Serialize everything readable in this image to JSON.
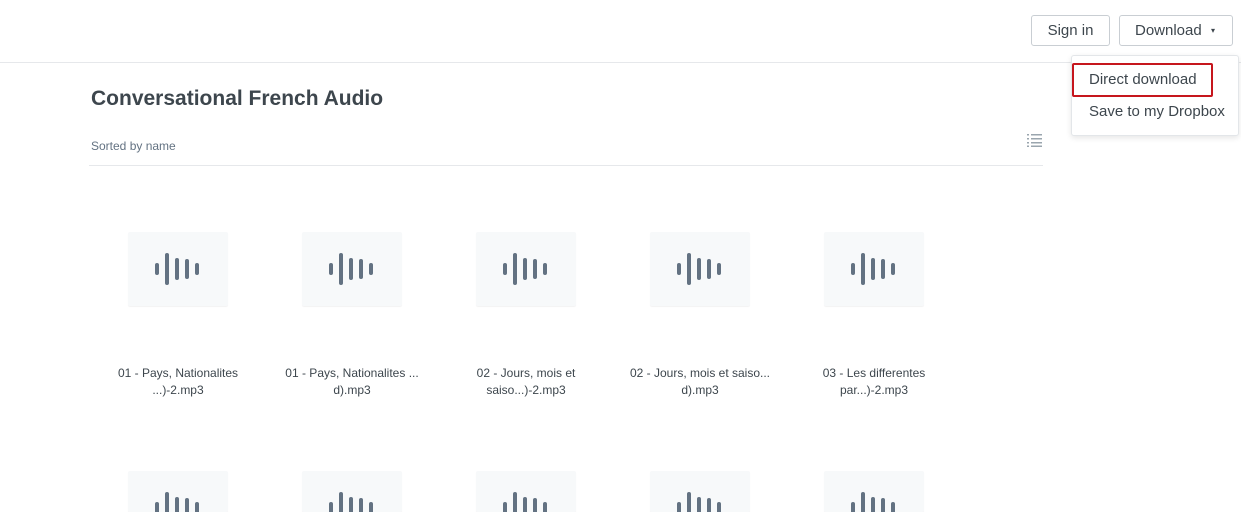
{
  "header": {
    "sign_in_label": "Sign in",
    "download_label": "Download",
    "download_caret": "▾"
  },
  "download_menu": {
    "items": [
      {
        "label": "Direct download",
        "highlighted": true
      },
      {
        "label": "Save to my Dropbox"
      }
    ]
  },
  "folder": {
    "title": "Conversational French Audio",
    "sort_label": "Sorted by name",
    "view_icon": "list-view-icon"
  },
  "files": [
    {
      "line1": "01 - Pays, Nationalites",
      "line2": "...)-2.mp3",
      "icon": "audio-waveform-icon"
    },
    {
      "line1": "01 - Pays, Nationalites ...",
      "line2": "d).mp3",
      "icon": "audio-waveform-icon"
    },
    {
      "line1": "02 - Jours, mois et",
      "line2": "saiso...)-2.mp3",
      "icon": "audio-waveform-icon"
    },
    {
      "line1": "02 - Jours, mois et saiso...",
      "line2": "d).mp3",
      "icon": "audio-waveform-icon"
    },
    {
      "line1": "03 - Les differentes",
      "line2": "par...)-2.mp3",
      "icon": "audio-waveform-icon"
    }
  ],
  "colors": {
    "highlight": "#c6161d",
    "icon": "#637282",
    "tile_bg": "#f7f9fa"
  }
}
